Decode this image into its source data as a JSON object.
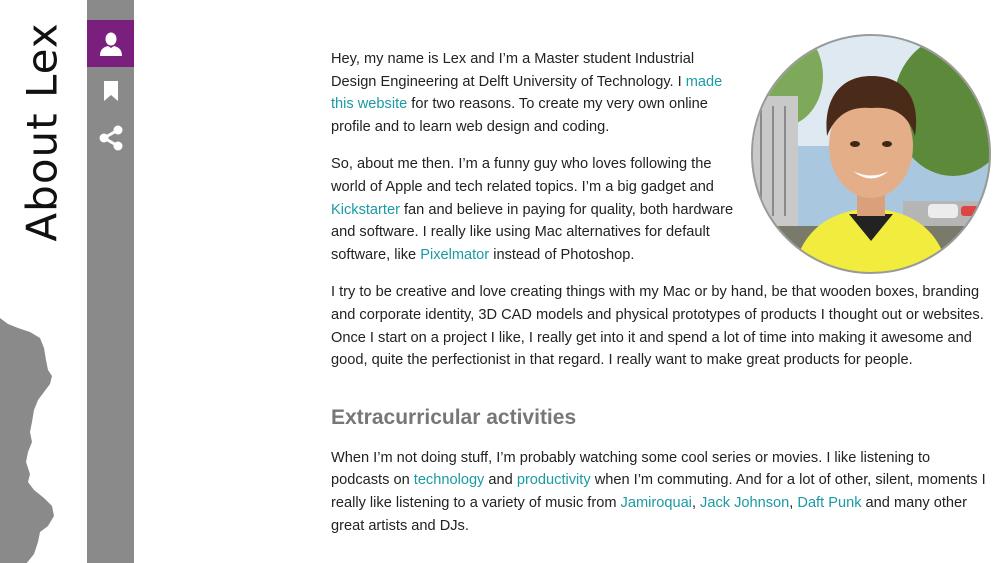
{
  "page_title": "About Lex",
  "sidebar": {
    "items": [
      {
        "name": "about",
        "icon": "user-icon",
        "active": true
      },
      {
        "name": "bookmarks",
        "icon": "bookmark-icon",
        "active": false
      },
      {
        "name": "share",
        "icon": "share-icon",
        "active": false
      }
    ],
    "accent_color": "#7b1f7e",
    "background_color": "#8a8a8a"
  },
  "profile_photo": {
    "icon": "portrait-photo"
  },
  "content": {
    "p1": {
      "t1": "Hey, my name is Lex and I’m a Master student Industrial Design Engineering at Delft University of Technology. I ",
      "link1": "made this website",
      "t2": " for two reasons. To create my very own online profile and to learn web design and coding."
    },
    "p2": {
      "t1": "So, about me then. I’m a funny guy who loves following the world of Apple and tech related topics. I’m a big gadget and ",
      "link1": "Kickstarter",
      "t2": " fan and believe in paying for quality, both hardware and software. I really like using Mac alternatives for default software, like ",
      "link2": "Pixelmator",
      "t3": " instead of Photoshop."
    },
    "p3": {
      "t1": "I try to be creative and love creating things with my Mac or by hand, be that wooden boxes, branding and corporate identity, 3D CAD models and physical prototypes of products I thought out or websites. Once I start on a project I like, I really get into it and spend a lot of time into making it awesome and good, quite the perfectionist in that regard. I really want to make great products for people."
    },
    "section_heading": "Extracurricular activities",
    "p4": {
      "t1": "When I’m not doing stuff, I’m probably watching some cool series or movies. I like listening to podcasts on ",
      "link1": "technology",
      "t2": " and ",
      "link2": "productivity",
      "t3": " when I’m commuting. And for a lot of other, silent, moments I really like listening to a variety of music from ",
      "link3": "Jamiroquai",
      "t4": ", ",
      "link4": "Jack Johnson",
      "t5": ", ",
      "link5": "Daft Punk",
      "t6": " and many other great artists and DJs."
    },
    "link_color": "#1b9aa3",
    "heading_color": "#777777"
  }
}
